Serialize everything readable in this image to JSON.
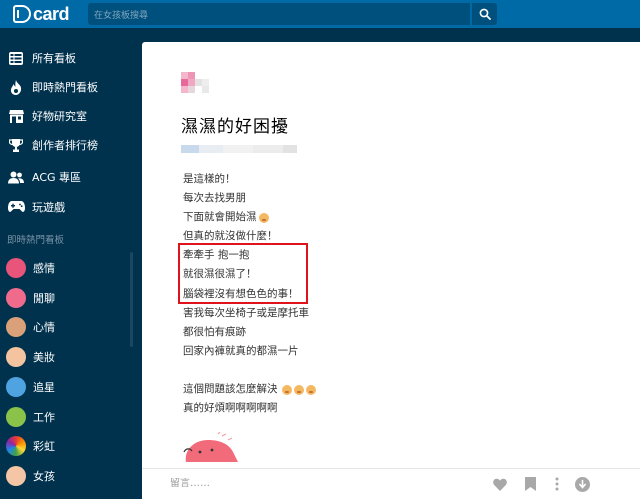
{
  "header": {
    "logo_text": "card",
    "search_placeholder": "在女孩板搜尋"
  },
  "sidebar": {
    "main_items": [
      {
        "label": "所有看板",
        "icon": "list-icon"
      },
      {
        "label": "即時熱門看板",
        "icon": "flame-icon"
      },
      {
        "label": "好物研究室",
        "icon": "store-icon"
      },
      {
        "label": "創作者排行榜",
        "icon": "trophy-icon"
      },
      {
        "label": "ACG 專區",
        "icon": "users-icon"
      },
      {
        "label": "玩遊戲",
        "icon": "gamepad-icon"
      }
    ],
    "section_label": "即時熱門看板",
    "forums": [
      {
        "label": "感情",
        "color": "#e9557a"
      },
      {
        "label": "閒聊",
        "color": "#f06a8c"
      },
      {
        "label": "心情",
        "color": "#d9a07a"
      },
      {
        "label": "美妝",
        "color": "#f4c4a0"
      },
      {
        "label": "追星",
        "color": "#4fa3e0"
      },
      {
        "label": "工作",
        "color": "#8bc34a"
      },
      {
        "label": "彩虹",
        "color": "#e05ab0"
      },
      {
        "label": "女孩",
        "color": "#f5c6a5"
      }
    ]
  },
  "post": {
    "title": "濕濕的好困擾",
    "lines": [
      "是這樣的！",
      "每次去找男朋",
      "下面就會開始濕",
      "但真的就沒做什麼！",
      "牽牽手 抱一抱",
      "就很濕很濕了！",
      "腦袋裡沒有想色色的事！",
      "害我每次坐椅子或是摩托車",
      "都很怕有痕跡",
      "回家內褲就真的都濕一片",
      "",
      "這個問題該怎麼解決",
      "真的好煩啊啊啊啊啊"
    ]
  },
  "footer": {
    "comment_placeholder": "留言……"
  },
  "colors": {
    "topbar": "#006aa6",
    "sidebar": "#00324e",
    "highlight_box": "#e0121c"
  }
}
